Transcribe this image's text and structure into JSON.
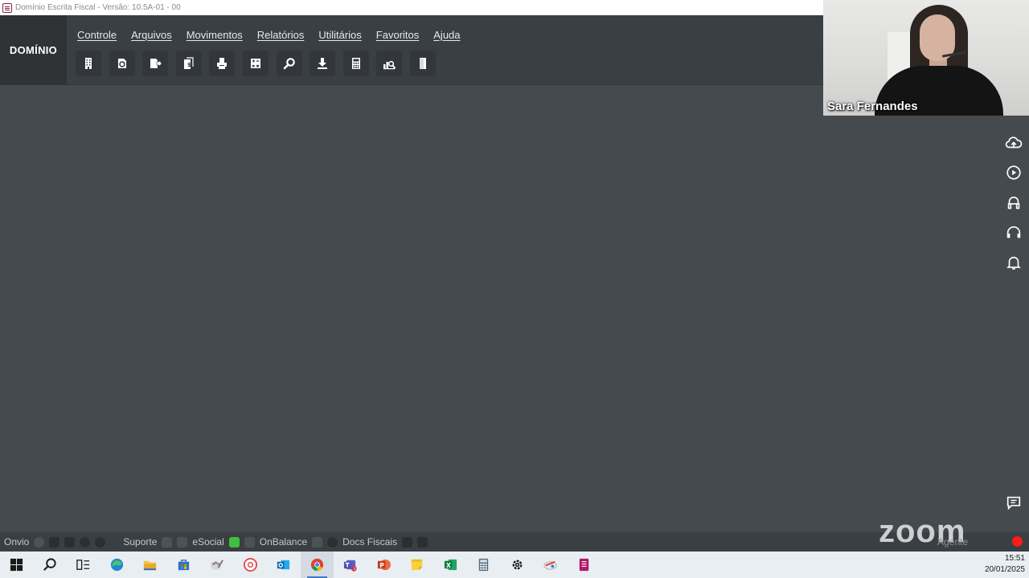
{
  "window": {
    "title": "Domínio Escrita Fiscal  - Versão: 10.5A-01 - 00"
  },
  "brand": {
    "label": "DOMÍNIO"
  },
  "menu": {
    "items": [
      "Controle",
      "Arquivos",
      "Movimentos",
      "Relatórios",
      "Utilitários",
      "Favoritos",
      "Ajuda"
    ]
  },
  "toolbar": {
    "buttons": [
      "building-icon",
      "refresh-doc-icon",
      "export-doc-icon",
      "invoice-dollar-icon",
      "printer-icon",
      "calc-sheet-icon",
      "search-icon",
      "download-icon",
      "calculator-icon",
      "chart-search-icon",
      "door-exit-icon"
    ]
  },
  "video": {
    "participant_name": "Sara Fernandes"
  },
  "sidebar_right": {
    "icons": [
      "cloud-upload-icon",
      "play-circle-icon",
      "academic-cap-icon",
      "headset-icon",
      "bell-icon",
      "chat-icon"
    ]
  },
  "statusbar": {
    "onvio": "Onvio",
    "suporte": "Suporte",
    "esocial": "eSocial",
    "onbalance": "OnBalance",
    "docs_fiscais": "Docs Fiscais",
    "agente": "Agente"
  },
  "zoom": {
    "logo_text": "zoom"
  },
  "taskbar": {
    "apps": [
      "windows-start-icon",
      "search-icon",
      "task-view-icon",
      "edge-icon",
      "file-explorer-icon",
      "store-icon",
      "paint-icon",
      "app-a-icon",
      "outlook-icon",
      "chrome-icon",
      "teams-icon",
      "powerpoint-icon",
      "sticky-notes-icon",
      "excel-icon",
      "calculator-icon",
      "settings-icon",
      "remote-icon",
      "dominio-icon"
    ],
    "teams_badge": "3"
  },
  "tray": {
    "time": "15:51",
    "date": "20/01/2025"
  },
  "colors": {
    "accent_record": "#ff1a1a",
    "workspace": "#454a4e",
    "ribbon": "#3a3f43"
  }
}
